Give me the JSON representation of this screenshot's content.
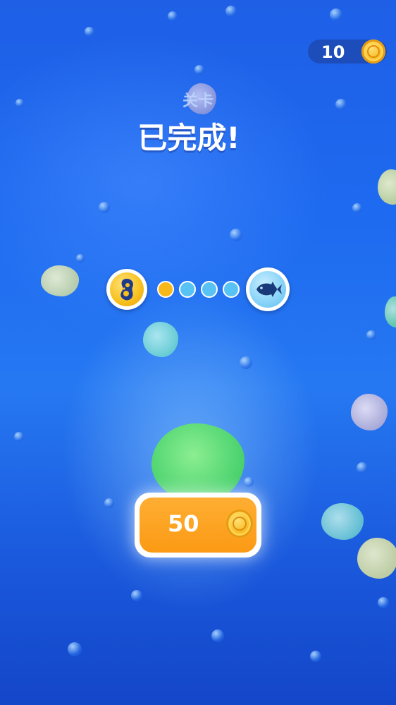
{
  "hud": {
    "coin_count": "10",
    "coin_icon": "gold-coin-icon"
  },
  "header": {
    "level_label": "关卡",
    "status_title": "已完成!"
  },
  "progress": {
    "start_icon": "cell-creature-icon",
    "end_icon": "fish-icon",
    "steps_total": 4,
    "steps_completed": 1,
    "colors": {
      "completed": "#f8b81a",
      "pending": "#59c2f4"
    }
  },
  "reward": {
    "amount": "50",
    "coin_icon": "gold-coin-icon"
  },
  "colors": {
    "background": "#1f64ea",
    "reward_button": "#fb9a14",
    "coin": "#f7b81c"
  }
}
